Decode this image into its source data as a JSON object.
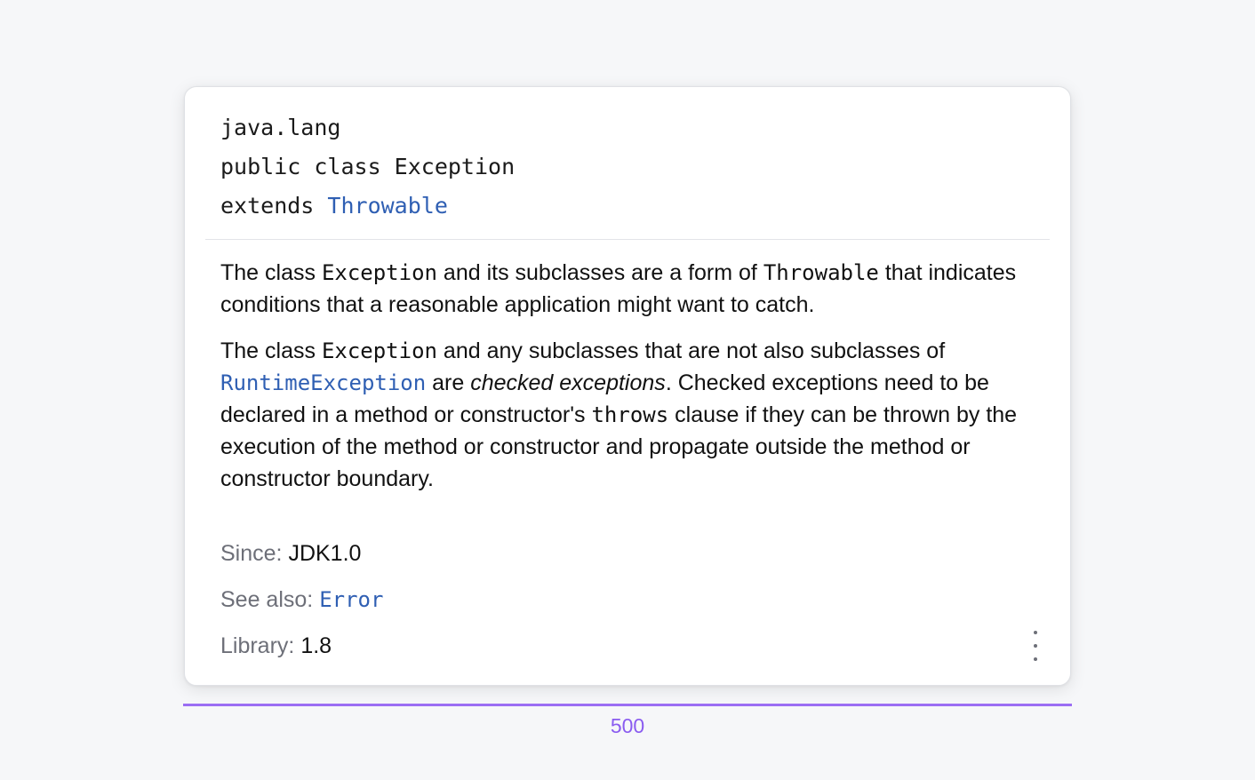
{
  "doc": {
    "package": "java.lang",
    "declaration": "public class Exception",
    "extends_keyword": "extends ",
    "extends_link": "Throwable",
    "para1": {
      "t1": "The class ",
      "c1": "Exception",
      "t2": " and its subclasses are a form of ",
      "c2": "Throwable",
      "t3": " that indicates conditions that a reasonable application might want to catch."
    },
    "para2": {
      "t1": "The class ",
      "c1": "Exception",
      "t2": " and any subclasses that are not also subclasses of ",
      "link1": "RuntimeException",
      "t3": " are ",
      "em": "checked exceptions",
      "t4": ". Checked exceptions need to be declared in a method or constructor's ",
      "c2": "throws",
      "t5": " clause if they can be thrown by the execution of the method or constructor and propagate outside the method or constructor boundary."
    },
    "since_label": "Since:",
    "since_value": "JDK1.0",
    "see_also_label": "See also:",
    "see_also_link": "Error",
    "library_label": "Library:",
    "library_value": "1.8"
  },
  "icons": {
    "more": "more-vertical-icon"
  },
  "measure": {
    "label": "500"
  },
  "colors": {
    "link": "#2f5fb3",
    "accent": "#9b6ef3",
    "muted": "#6d6f78"
  }
}
